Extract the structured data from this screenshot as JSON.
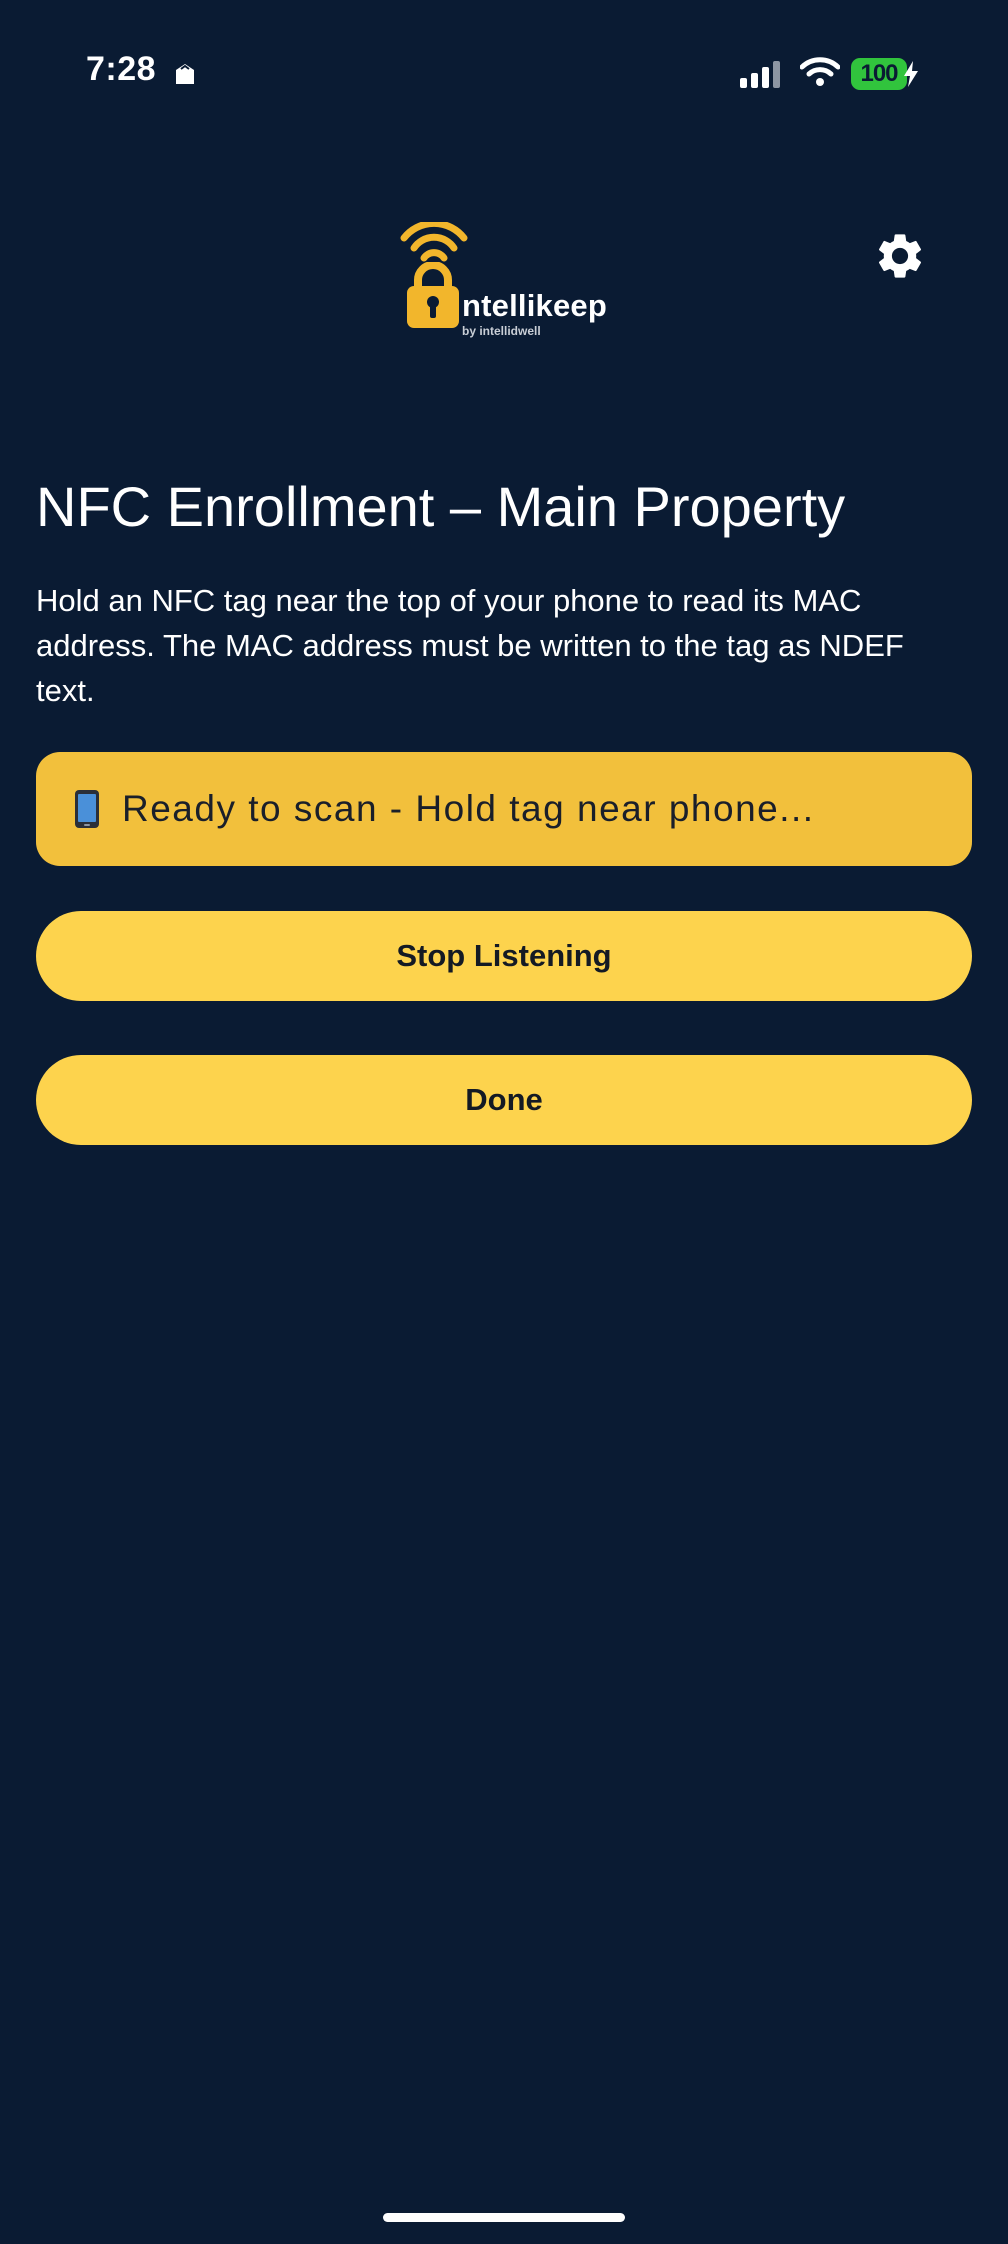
{
  "status_bar": {
    "time": "7:28",
    "app_icon": "scan-app-icon",
    "signal_icon": "cellular-signal-icon",
    "wifi_icon": "wifi-icon",
    "battery_level": "100",
    "charging_icon": "charging-bolt-icon"
  },
  "header": {
    "logo_brand": "ntellikeep",
    "logo_sub": "by intellidwell",
    "settings_icon": "gear-icon"
  },
  "main": {
    "title": "NFC Enrollment – Main Property",
    "instructions": "Hold an NFC tag near the top of your phone to read its MAC address. The MAC address must be written to the tag as NDEF text.",
    "status_text": "Ready to scan - Hold tag near phone...",
    "status_icon": "mobile-phone-icon",
    "stop_button_label": "Stop Listening",
    "done_button_label": "Done"
  },
  "colors": {
    "background": "#0a1b33",
    "accent": "#fdd34d",
    "status_panel": "#f2c03c",
    "battery": "#31c43d"
  }
}
